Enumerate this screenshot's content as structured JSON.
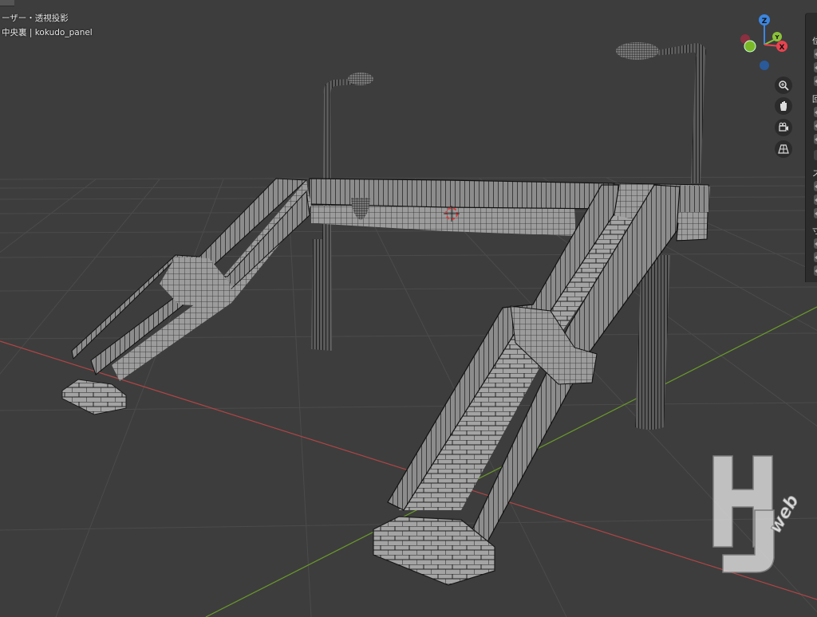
{
  "viewport": {
    "title": "ーザー・透視投影",
    "collection": "中央裏 | kokudo_panel"
  },
  "gizmo": {
    "z_label": "Z",
    "y_label": "Y",
    "x_label": "X"
  },
  "nav_tools": [
    {
      "name": "zoom-icon"
    },
    {
      "name": "hand-pan-icon"
    },
    {
      "name": "camera-view-icon"
    },
    {
      "name": "perspective-grid-icon"
    }
  ],
  "side_panel": {
    "labels": [
      "位",
      "回",
      "ス",
      "寸"
    ]
  },
  "watermark": {
    "letters": "HJ",
    "word": "web"
  },
  "colors": {
    "background": "#3d3d3d",
    "grid": "#4a4a4a",
    "x_axis": "#b04545",
    "y_axis": "#6a9a2a",
    "mesh_fill": "#9a9a9a",
    "wire": "#111111",
    "gizmo_x": "#e8434f",
    "gizmo_y": "#8ac13a",
    "gizmo_z": "#3c86e0"
  }
}
